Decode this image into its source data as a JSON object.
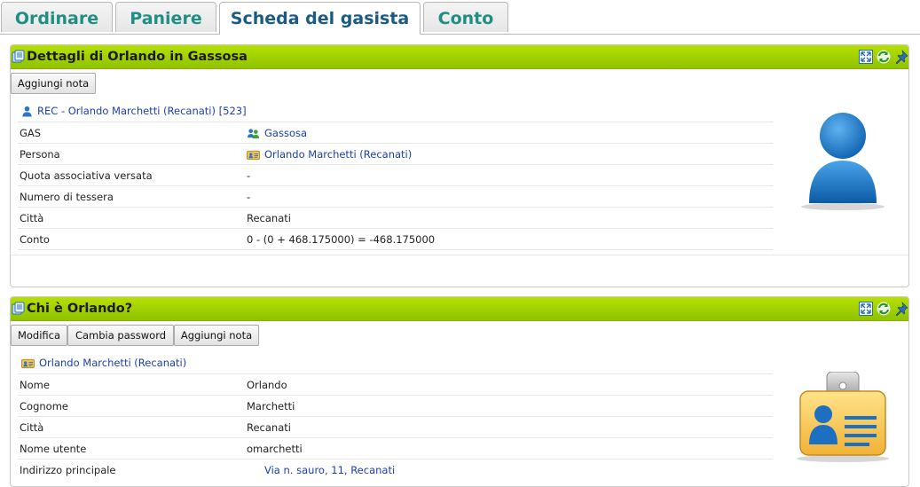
{
  "tabs": [
    {
      "label": "Ordinare"
    },
    {
      "label": "Paniere"
    },
    {
      "label": "Scheda del gasista"
    },
    {
      "label": "Conto"
    }
  ],
  "panel1": {
    "title": "Dettagli di Orlando in Gassosa",
    "buttons": {
      "add_note": "Aggiungi nota"
    },
    "link": "REC - Orlando Marchetti (Recanati) [523]",
    "rows": [
      {
        "label": "GAS",
        "value": "Gassosa"
      },
      {
        "label": "Persona",
        "value": "Orlando Marchetti (Recanati)"
      },
      {
        "label": "Quota associativa versata",
        "value": "-"
      },
      {
        "label": "Numero di tessera",
        "value": "-"
      },
      {
        "label": "Città",
        "value": "Recanati"
      },
      {
        "label": "Conto",
        "value": "0 - (0 + 468.175000) = -468.175000"
      }
    ],
    "image_icon": "user-avatar-icon"
  },
  "panel2": {
    "title": "Chi è Orlando?",
    "buttons": {
      "edit": "Modifica",
      "change_password": "Cambia password",
      "add_note": "Aggiungi nota"
    },
    "link": "Orlando Marchetti (Recanati)",
    "rows": [
      {
        "label": "Nome",
        "value": "Orlando"
      },
      {
        "label": "Cognome",
        "value": "Marchetti"
      },
      {
        "label": "Città",
        "value": "Recanati"
      },
      {
        "label": "Nome utente",
        "value": "omarchetti"
      },
      {
        "label": "Indirizzo principale",
        "value": "Via n. sauro, 11, Recanati"
      }
    ],
    "image_icon": "id-badge-icon"
  },
  "colors": {
    "header_green": "#a3d200",
    "tab_text": "#1f8f86",
    "tab_active_text": "#1a5b86",
    "link": "#1a3fae"
  }
}
